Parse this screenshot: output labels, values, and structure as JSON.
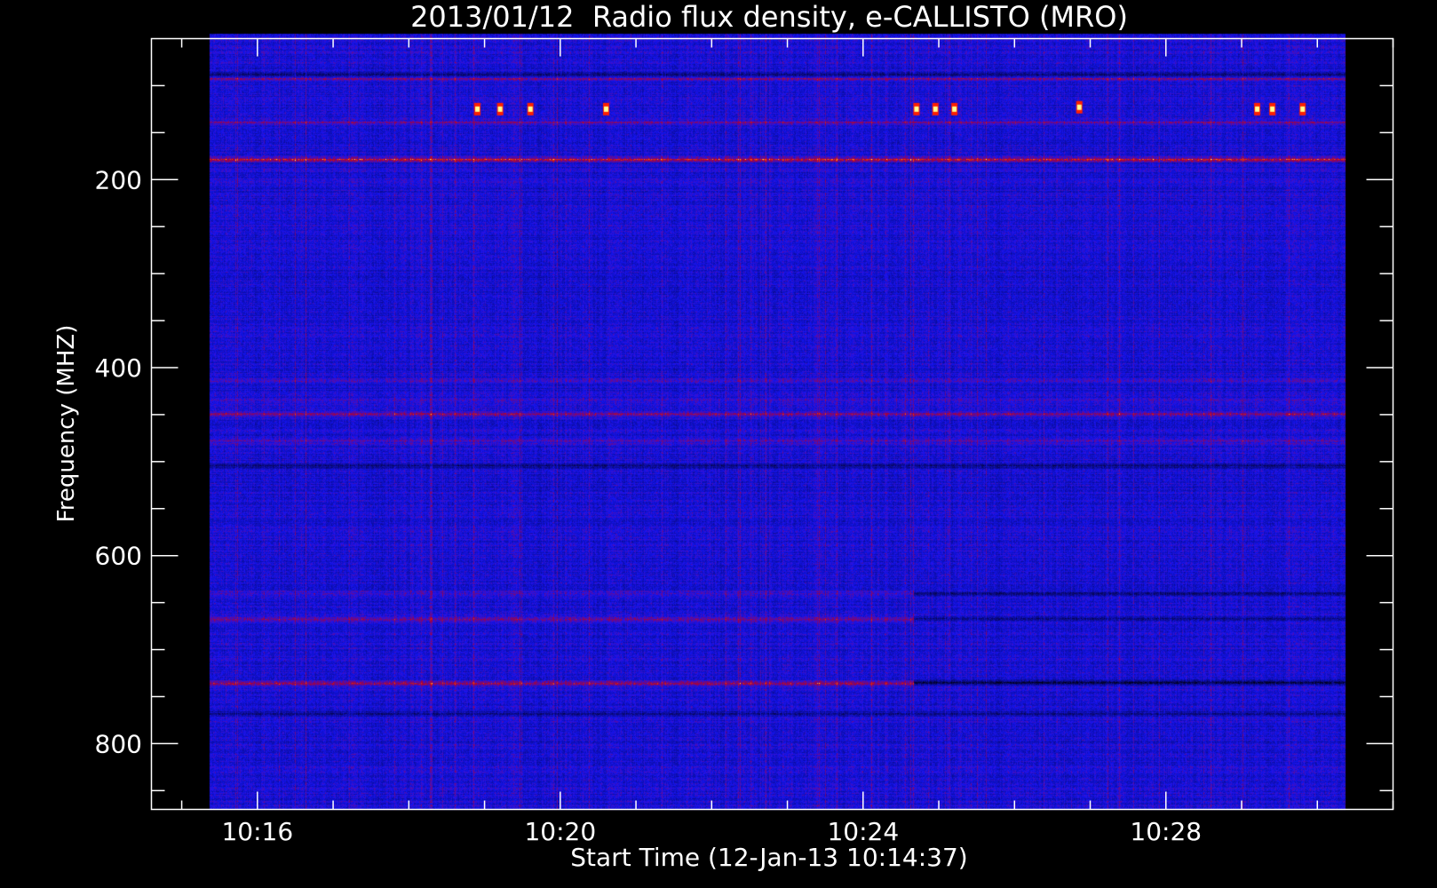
{
  "chart_data": {
    "type": "heatmap",
    "title": "2013/01/12  Radio flux density, e-CALLISTO (MRO)",
    "xlabel": "Start Time (12-Jan-13 10:14:37)",
    "ylabel": "Frequency (MHZ)",
    "x_tick_labels": [
      "10:16",
      "10:20",
      "10:24",
      "10:28"
    ],
    "x_tick_values_min": [
      16,
      20,
      24,
      28
    ],
    "x_range_min": [
      14.6,
      31.0
    ],
    "y_tick_labels": [
      "200",
      "400",
      "600",
      "800"
    ],
    "y_tick_values": [
      200,
      400,
      600,
      800
    ],
    "y_range": [
      50,
      870
    ],
    "y_inverted": true,
    "data_extent": {
      "time_min": [
        15.37,
        30.37
      ],
      "freq_mhz": [
        45,
        870
      ]
    },
    "colormap": [
      "#000000",
      "#0000ff",
      "#c00000",
      "#ff2000",
      "#ffff80",
      "#ffffff"
    ],
    "background_color": "#1e1ef0",
    "bands_mhz": [
      {
        "freq": 88,
        "level": -0.5,
        "label": "dark"
      },
      {
        "freq": 92,
        "level": 0.35,
        "label": "red"
      },
      {
        "freq": 139,
        "level": 0.35,
        "label": "red"
      },
      {
        "freq": 178,
        "level": 0.6,
        "label": "bright red"
      },
      {
        "freq": 413,
        "level": 0.25,
        "label": "red"
      },
      {
        "freq": 434,
        "level": 0.2,
        "label": "red"
      },
      {
        "freq": 449,
        "level": 0.4,
        "label": "red"
      },
      {
        "freq": 478,
        "level": 0.3,
        "label": "red dark"
      },
      {
        "freq": 504,
        "level": -0.4,
        "label": "dark"
      },
      {
        "freq": 640,
        "level": 0.3,
        "label": "red"
      },
      {
        "freq": 667,
        "level": 0.35,
        "label": "red"
      },
      {
        "freq": 735,
        "level": 0.55,
        "label": "red then dark"
      },
      {
        "freq": 768,
        "level": -0.4,
        "label": "dark"
      }
    ],
    "bursts": [
      {
        "time_min": 18.9,
        "freq": 125
      },
      {
        "time_min": 19.2,
        "freq": 125
      },
      {
        "time_min": 19.6,
        "freq": 125
      },
      {
        "time_min": 20.6,
        "freq": 125
      },
      {
        "time_min": 24.7,
        "freq": 125
      },
      {
        "time_min": 24.95,
        "freq": 125
      },
      {
        "time_min": 25.2,
        "freq": 125
      },
      {
        "time_min": 26.85,
        "freq": 123
      },
      {
        "time_min": 29.2,
        "freq": 125
      },
      {
        "time_min": 29.4,
        "freq": 125
      },
      {
        "time_min": 29.8,
        "freq": 125
      }
    ]
  }
}
